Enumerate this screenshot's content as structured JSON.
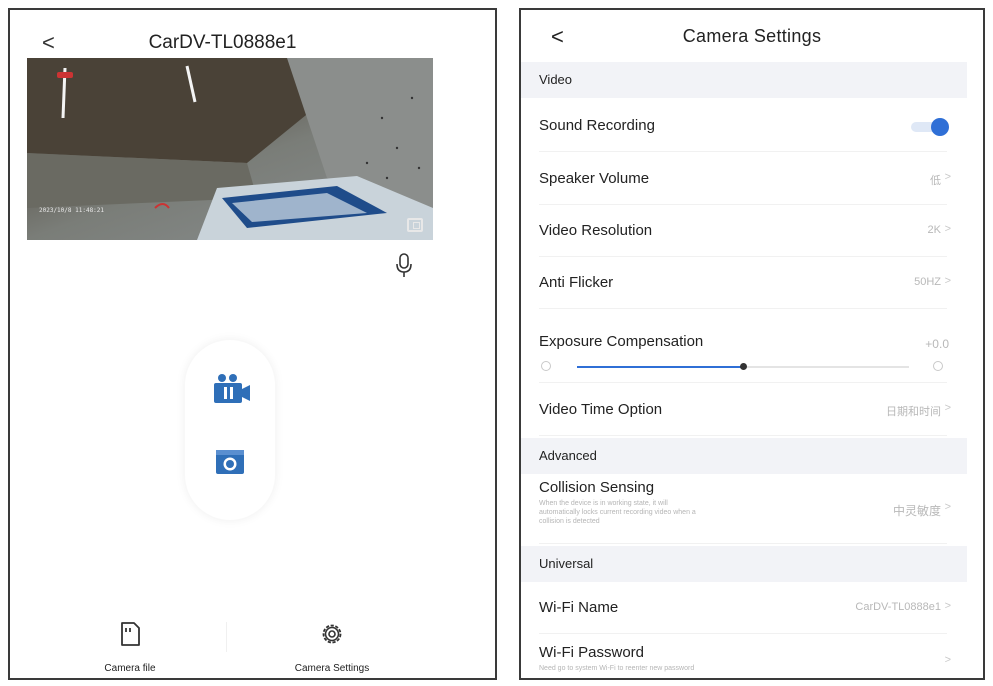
{
  "left": {
    "device_name": "CarDV-TL0888e1",
    "preview": {
      "timestamp": "2023/10/8 11:48:21"
    },
    "tabs": [
      {
        "label": "Camera file",
        "icon": "sd-card-icon"
      },
      {
        "label": "Camera Settings",
        "icon": "gear-icon"
      }
    ]
  },
  "right": {
    "title": "Camera Settings",
    "sections": {
      "video": "Video",
      "advanced": "Advanced",
      "universal": "Universal"
    },
    "rows": {
      "sound_recording": {
        "label": "Sound Recording",
        "enabled": true
      },
      "speaker_volume": {
        "label": "Speaker Volume",
        "value": "低"
      },
      "video_resolution": {
        "label": "Video Resolution",
        "value": "2K"
      },
      "anti_flicker": {
        "label": "Anti Flicker",
        "value": "50HZ"
      },
      "exposure": {
        "label": "Exposure Compensation",
        "value": "+0.0",
        "level": 0.5
      },
      "video_time": {
        "label": "Video Time Option",
        "value": "日期和时间"
      },
      "collision": {
        "label": "Collision Sensing",
        "sub1": "When the device is in working state, it will",
        "sub2": "automatically locks current recording video when a",
        "sub3": "collision is detected",
        "value": "中灵敏度"
      },
      "wifi_name": {
        "label": "Wi-Fi Name",
        "value": "CarDV-TL0888e1"
      },
      "wifi_password": {
        "label": "Wi-Fi Password",
        "sub": "Need go to system Wi-Fi to reenter new password"
      }
    },
    "chevron": ">"
  },
  "colors": {
    "accent": "#2f6fd6",
    "section_bg": "#f2f3f7",
    "muted_text": "#b8b8b8"
  }
}
